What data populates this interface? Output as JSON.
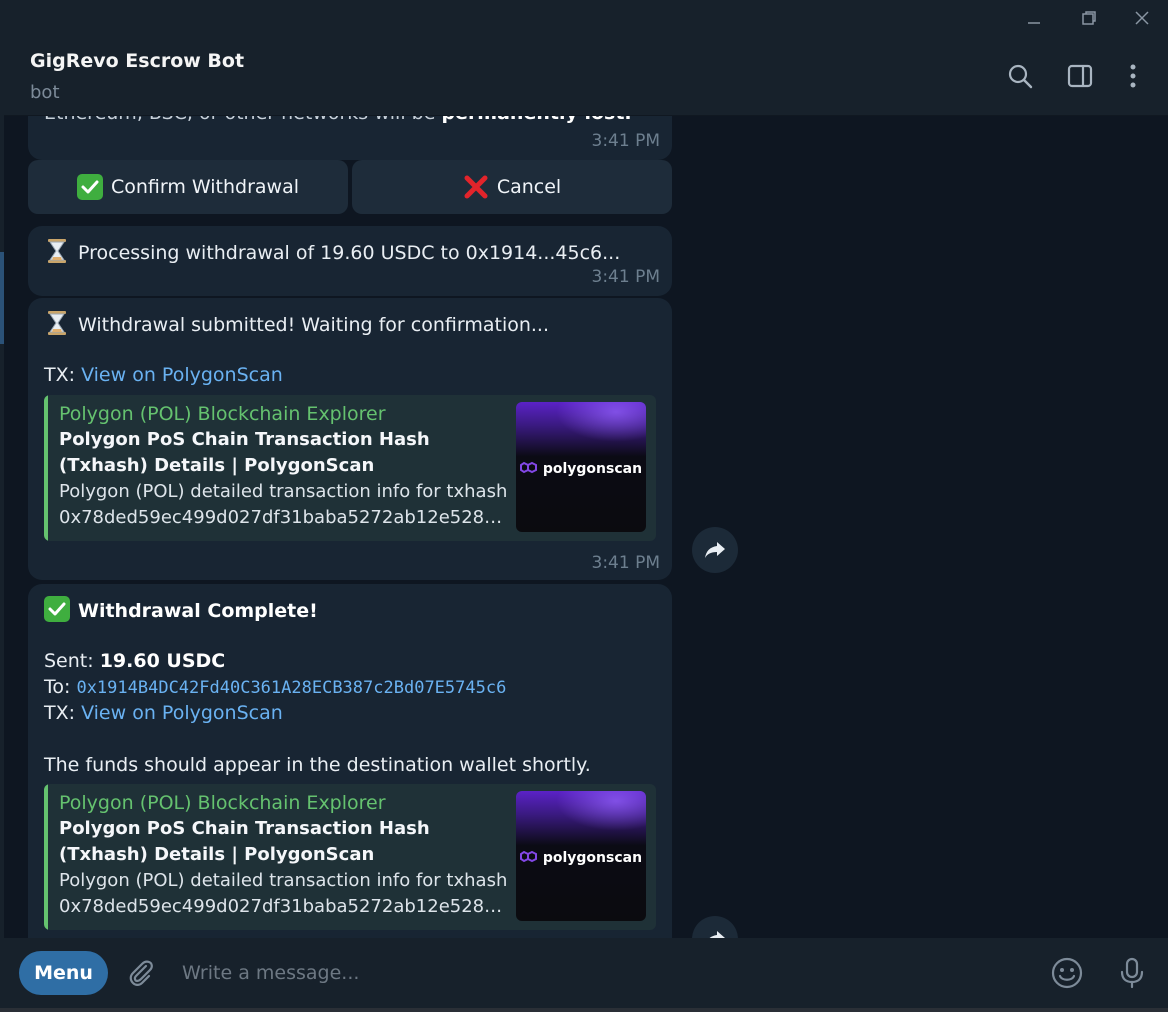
{
  "header": {
    "title": "GigRevo Escrow Bot",
    "subtitle": "bot"
  },
  "messages": {
    "warning": {
      "text_prefix": "Ethereum, BSC, or other networks will be ",
      "text_bold": "permanently lost.",
      "time": "3:41 PM"
    },
    "keyboard": {
      "confirm_label": "Confirm Withdrawal",
      "cancel_label": "Cancel"
    },
    "processing": {
      "text": "Processing withdrawal of 19.60 USDC to 0x1914...45c6...",
      "time": "3:41 PM"
    },
    "submitted": {
      "text": "Withdrawal submitted! Waiting for confirmation...",
      "tx_label": "TX:",
      "tx_link": "View on PolygonScan",
      "time": "3:41 PM",
      "preview": {
        "site": "Polygon (POL) Blockchain Explorer",
        "title": "Polygon PoS Chain Transaction Hash (Txhash) Details | PolygonScan",
        "desc_line1": "Polygon (POL) detailed transaction info for txhash",
        "desc_line2": "0x78ded59ec499d027df31baba5272ab12e528c...",
        "thumb_brand": "polygonscan"
      }
    },
    "complete": {
      "title": "Withdrawal Complete!",
      "sent_label": "Sent:",
      "sent_value": "19.60 USDC",
      "to_label": "To:",
      "to_value": "0x1914B4DC42Fd40C361A28ECB387c2Bd07E5745c6",
      "tx_label": "TX:",
      "tx_link": "View on PolygonScan",
      "note": "The funds should appear in the destination wallet shortly.",
      "preview": {
        "site": "Polygon (POL) Blockchain Explorer",
        "title": "Polygon PoS Chain Transaction Hash (Txhash) Details | PolygonScan",
        "desc_line1": "Polygon (POL) detailed transaction info for txhash",
        "desc_line2": "0x78ded59ec499d027df31baba5272ab12e528c...",
        "thumb_brand": "polygonscan"
      }
    }
  },
  "composer": {
    "menu_label": "Menu",
    "placeholder": "Write a message..."
  },
  "colors": {
    "background": "#0e1621",
    "bubble": "#182533",
    "link": "#6ab2f2",
    "preview_accent": "#65c26f",
    "menu_button": "#2f6ea5"
  }
}
